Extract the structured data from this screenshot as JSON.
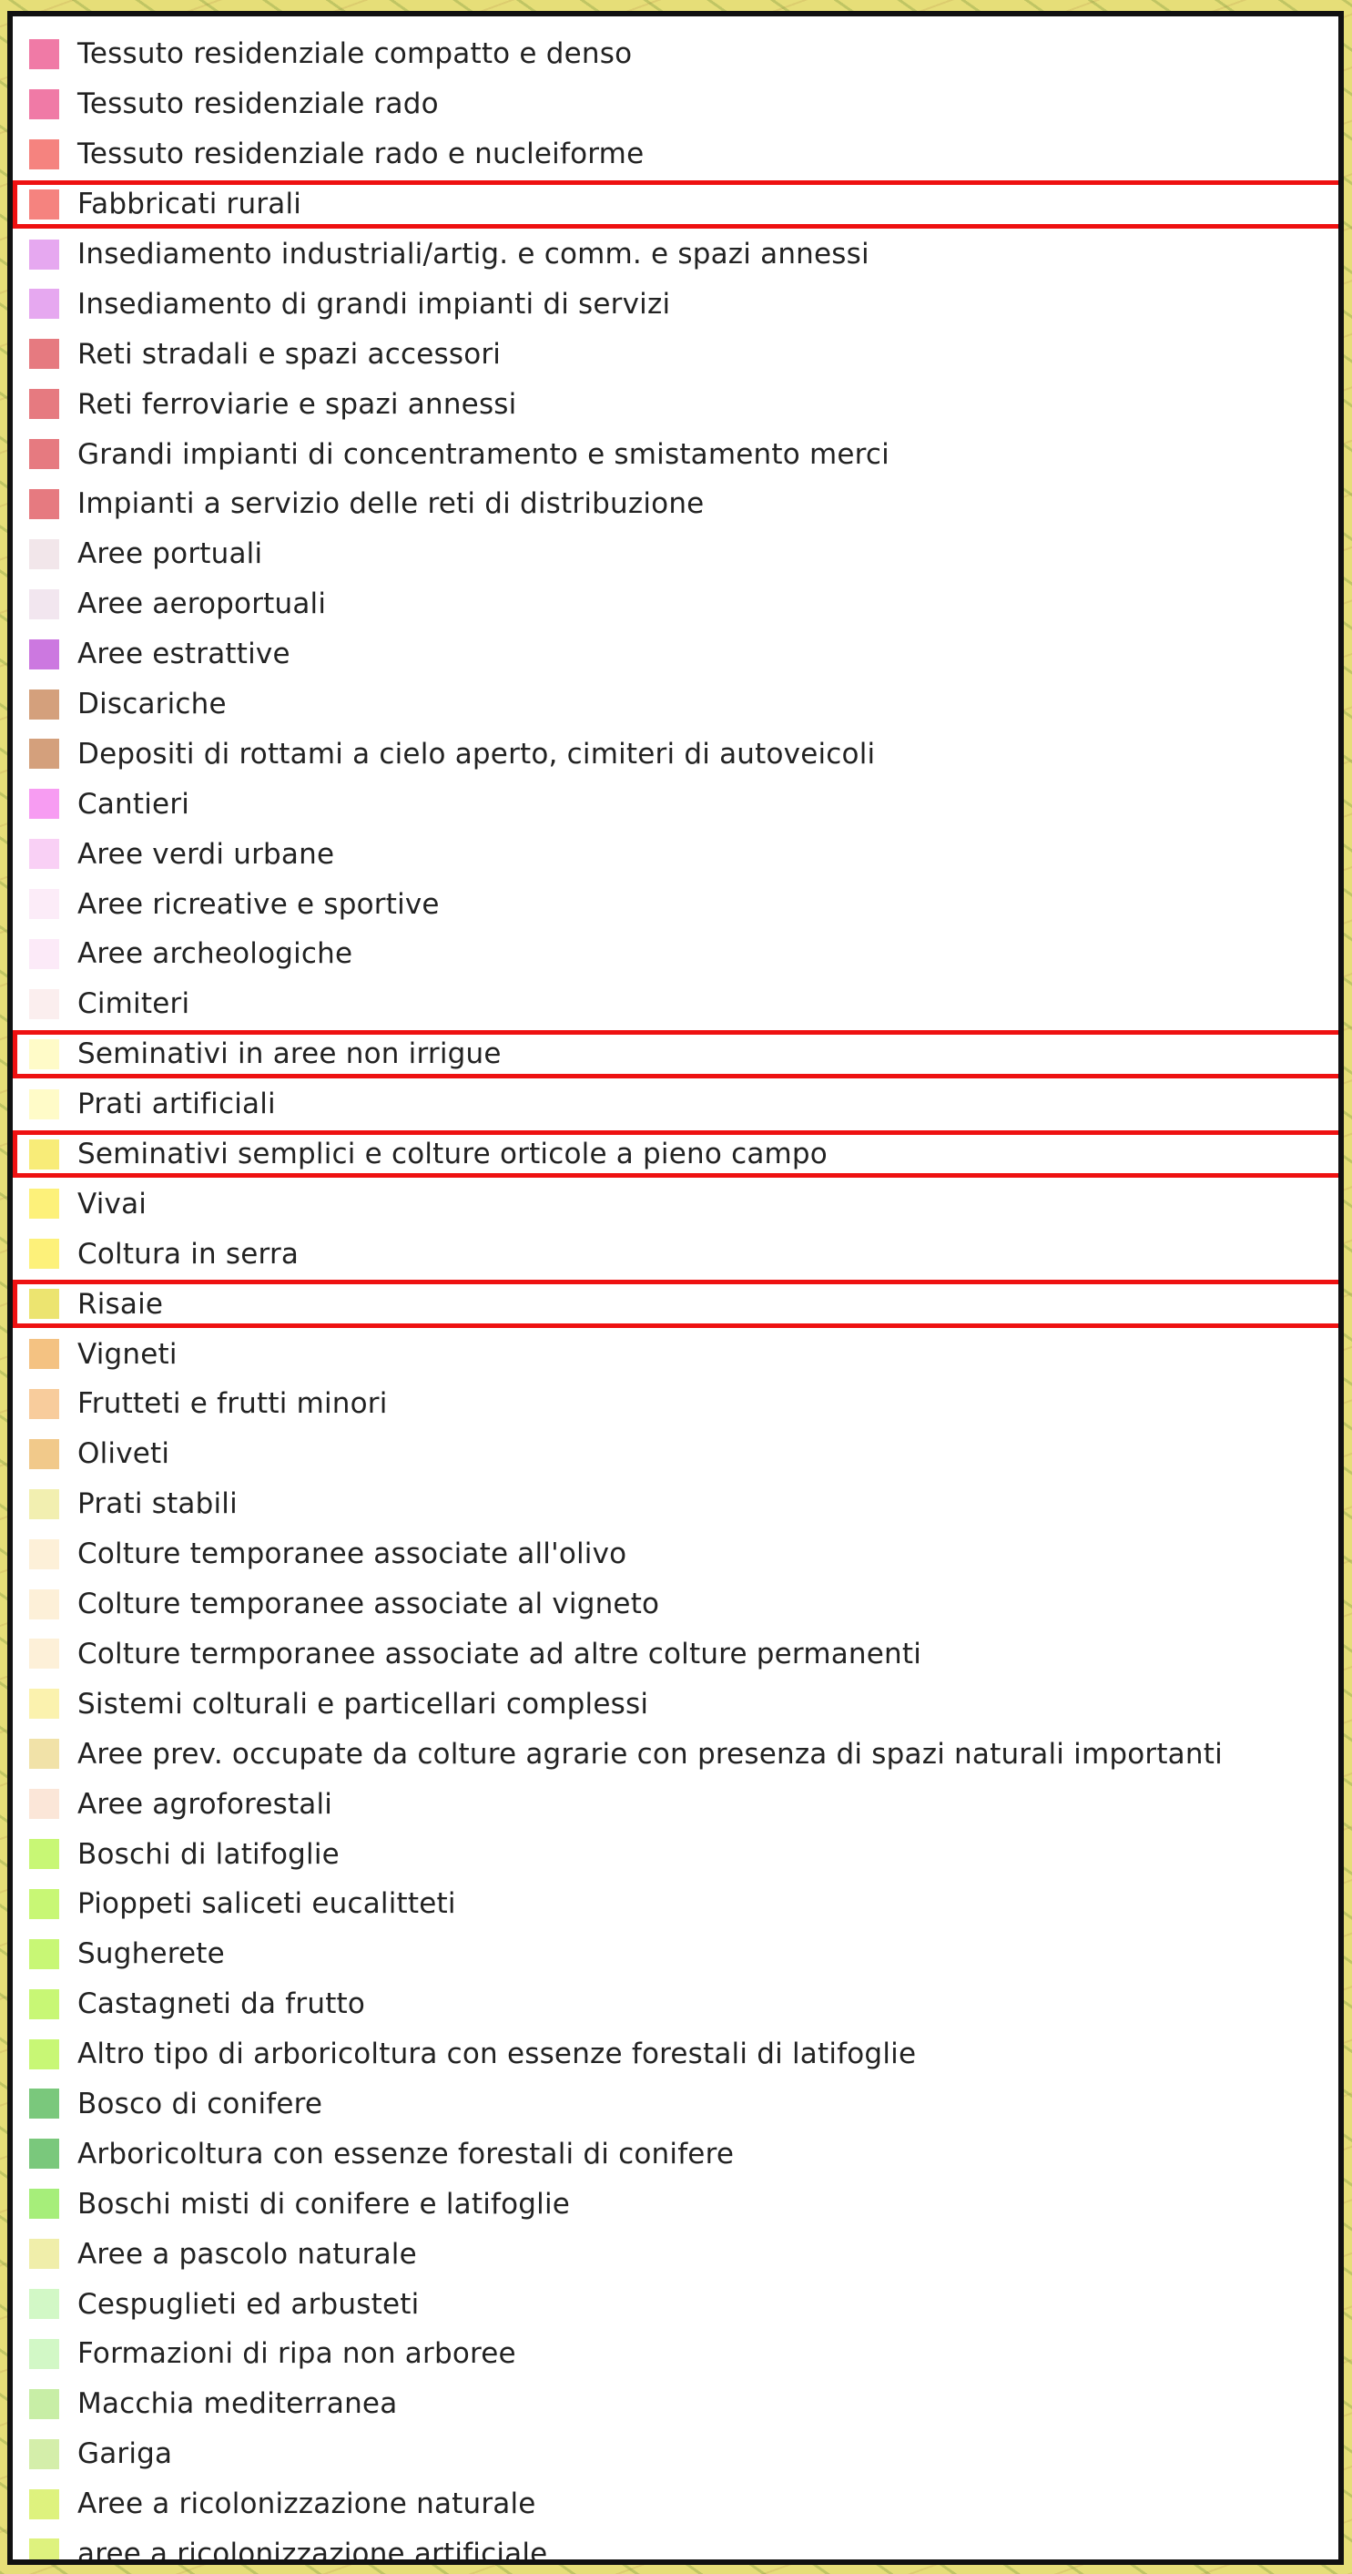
{
  "legend": {
    "items": [
      {
        "label": "Tessuto residenziale compatto e denso",
        "color": "#f07aa6",
        "highlighted": false
      },
      {
        "label": "Tessuto residenziale rado",
        "color": "#f07aa6",
        "highlighted": false
      },
      {
        "label": "Tessuto residenziale rado e nucleiforme",
        "color": "#f5837f",
        "highlighted": false
      },
      {
        "label": "Fabbricati rurali",
        "color": "#f5837f",
        "highlighted": true
      },
      {
        "label": "Insediamento industriali/artig. e  comm. e spazi annessi",
        "color": "#e6a8f0",
        "highlighted": false
      },
      {
        "label": "Insediamento di grandi impianti di servizi",
        "color": "#e6a8f0",
        "highlighted": false
      },
      {
        "label": "Reti stradali e spazi accessori",
        "color": "#e67a80",
        "highlighted": false
      },
      {
        "label": "Reti ferroviarie e spazi annessi",
        "color": "#e67a80",
        "highlighted": false
      },
      {
        "label": "Grandi impianti di concentramento e smistamento merci",
        "color": "#e67a80",
        "highlighted": false
      },
      {
        "label": "Impianti a servizio delle reti di distribuzione",
        "color": "#e67a80",
        "highlighted": false
      },
      {
        "label": "Aree portuali",
        "color": "#f2e6ea",
        "highlighted": false
      },
      {
        "label": "Aree aeroportuali",
        "color": "#f2e6ef",
        "highlighted": false
      },
      {
        "label": "Aree estrattive",
        "color": "#cc78e0",
        "highlighted": false
      },
      {
        "label": "Discariche",
        "color": "#d4a07c",
        "highlighted": false
      },
      {
        "label": "Depositi di rottami a cielo aperto, cimiteri di autoveicoli",
        "color": "#d4a07c",
        "highlighted": false
      },
      {
        "label": "Cantieri",
        "color": "#f79cf2",
        "highlighted": false
      },
      {
        "label": "Aree verdi urbane",
        "color": "#f9d0f5",
        "highlighted": false
      },
      {
        "label": "Aree ricreative e sportive",
        "color": "#fcecf8",
        "highlighted": false
      },
      {
        "label": "Aree archeologiche",
        "color": "#fceaf8",
        "highlighted": false
      },
      {
        "label": "Cimiteri",
        "color": "#fbeeee",
        "highlighted": false
      },
      {
        "label": "Seminativi in aree non irrigue",
        "color": "#fffbc8",
        "highlighted": true
      },
      {
        "label": "Prati artificiali",
        "color": "#fffbc8",
        "highlighted": false
      },
      {
        "label": "Seminativi semplici e colture orticole a pieno campo",
        "color": "#f8ec78",
        "highlighted": true
      },
      {
        "label": "Vivai",
        "color": "#fdf17a",
        "highlighted": false
      },
      {
        "label": "Coltura in serra",
        "color": "#fdf17a",
        "highlighted": false
      },
      {
        "label": "Risaie",
        "color": "#ece470",
        "highlighted": true
      },
      {
        "label": "Vigneti",
        "color": "#f4c282",
        "highlighted": false
      },
      {
        "label": "Frutteti e frutti minori",
        "color": "#f8cc9c",
        "highlighted": false
      },
      {
        "label": "Oliveti",
        "color": "#f1c98a",
        "highlighted": false
      },
      {
        "label": "Prati stabili",
        "color": "#f2efb0",
        "highlighted": false
      },
      {
        "label": "Colture temporanee associate all'olivo",
        "color": "#fdf0d8",
        "highlighted": false
      },
      {
        "label": "Colture temporanee associate al vigneto",
        "color": "#fdf0d8",
        "highlighted": false
      },
      {
        "label": "Colture termporanee associate ad altre colture permanenti",
        "color": "#fdf0d8",
        "highlighted": false
      },
      {
        "label": "Sistemi colturali e particellari complessi",
        "color": "#fbf2ae",
        "highlighted": false
      },
      {
        "label": "Aree prev. occupate da colture agrarie con presenza di spazi naturali importanti",
        "color": "#f1e2a8",
        "highlighted": false
      },
      {
        "label": "Aree agroforestali",
        "color": "#fbe6d8",
        "highlighted": false
      },
      {
        "label": "Boschi di latifoglie",
        "color": "#c8f775",
        "highlighted": false
      },
      {
        "label": "Pioppeti saliceti eucalitteti",
        "color": "#c8f775",
        "highlighted": false
      },
      {
        "label": "Sugherete",
        "color": "#c8f775",
        "highlighted": false
      },
      {
        "label": "Castagneti da frutto",
        "color": "#c8f775",
        "highlighted": false
      },
      {
        "label": "Altro tipo di arboricoltura con essenze forestali di latifoglie",
        "color": "#c8f775",
        "highlighted": false
      },
      {
        "label": "Bosco di conifere",
        "color": "#7ac87c",
        "highlighted": false
      },
      {
        "label": "Arboricoltura con essenze forestali di conifere",
        "color": "#7ac87c",
        "highlighted": false
      },
      {
        "label": "Boschi misti di conifere e latifoglie",
        "color": "#a6ee7a",
        "highlighted": false
      },
      {
        "label": "Aree a pascolo naturale",
        "color": "#f0eeaa",
        "highlighted": false
      },
      {
        "label": "Cespuglieti ed arbusteti",
        "color": "#d2f8c6",
        "highlighted": false
      },
      {
        "label": "Formazioni di ripa non arboree",
        "color": "#d2f8c6",
        "highlighted": false
      },
      {
        "label": "Macchia mediterranea",
        "color": "#c8eea6",
        "highlighted": false
      },
      {
        "label": "Gariga",
        "color": "#d4eeaa",
        "highlighted": false
      },
      {
        "label": "Aree a ricolonizzazione naturale",
        "color": "#def27e",
        "highlighted": false
      },
      {
        "label": "aree a ricolonizzazione artificiale",
        "color": "#def27e",
        "highlighted": false
      }
    ]
  }
}
